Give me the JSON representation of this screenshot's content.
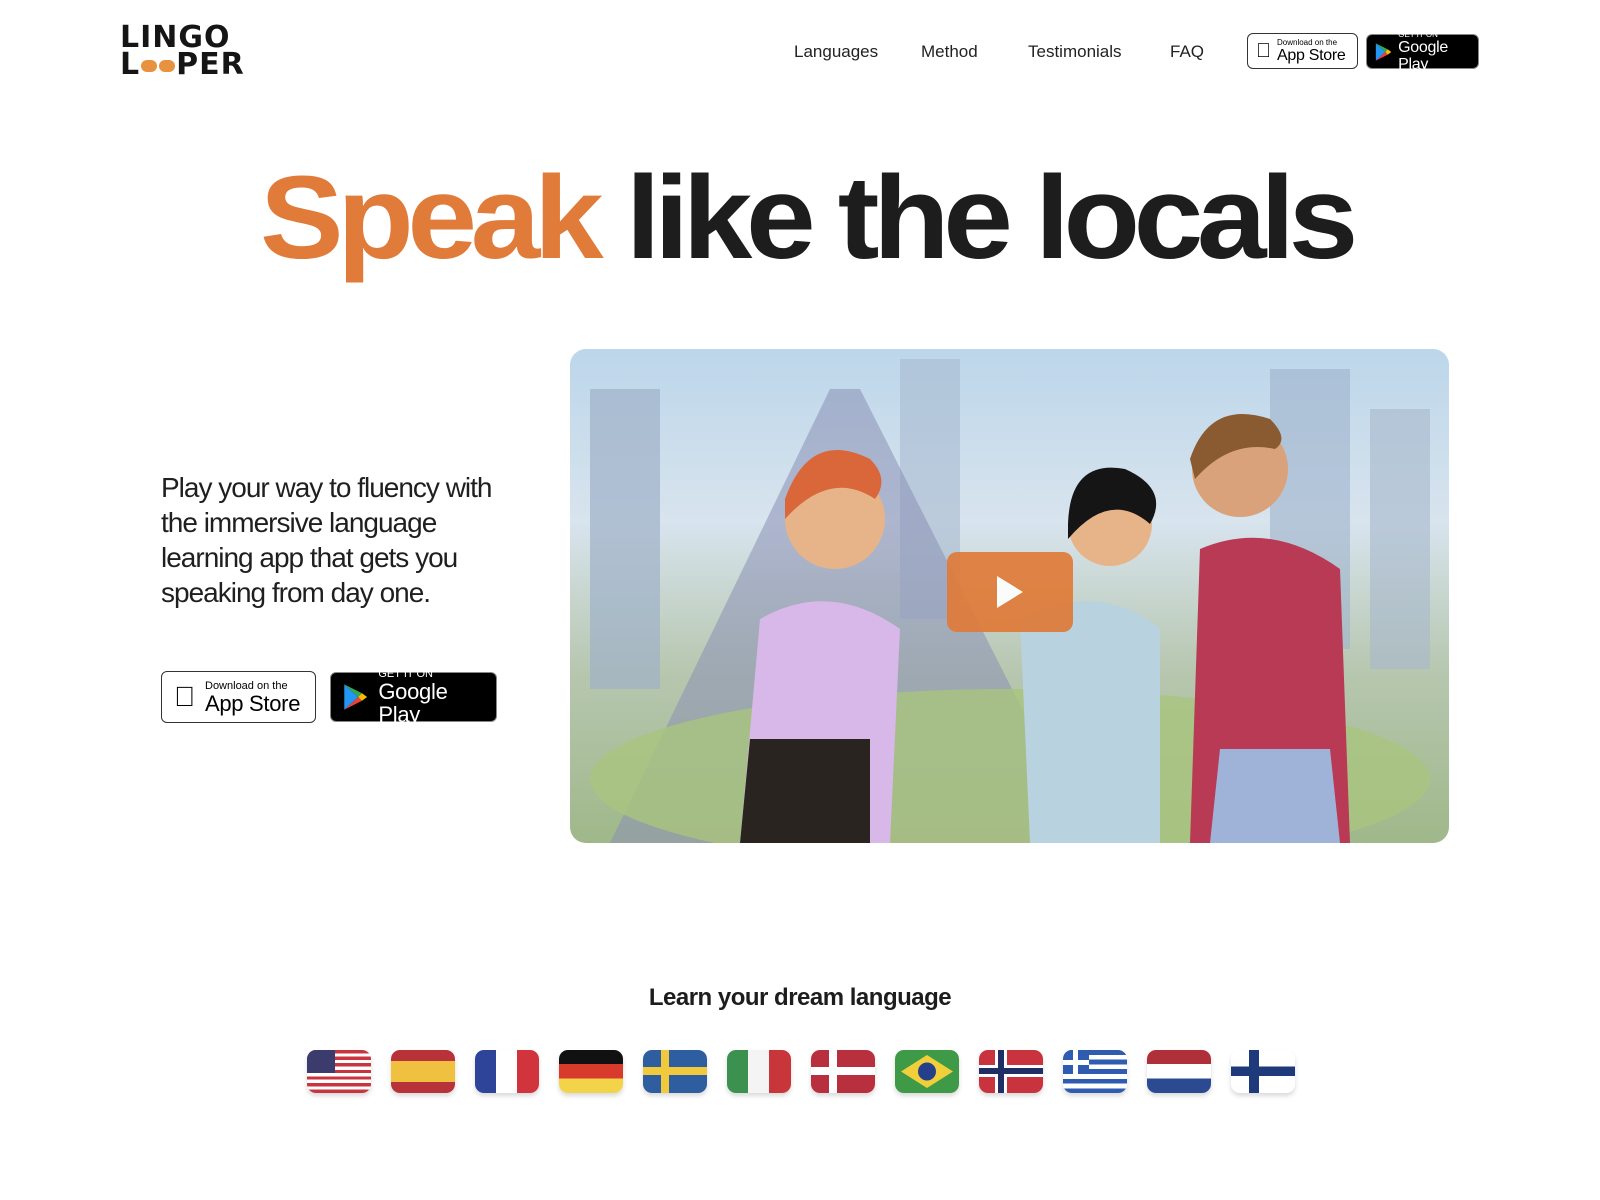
{
  "logo": {
    "line1": "LINGO",
    "line2_a": "L",
    "line2_b": "PER"
  },
  "nav": {
    "items": [
      "Languages",
      "Method",
      "Testimonials",
      "FAQ"
    ]
  },
  "badges": {
    "app_store": {
      "small": "Download on the",
      "big": "App Store"
    },
    "google_play": {
      "small": "GET IT ON",
      "big": "Google Play"
    }
  },
  "hero": {
    "headline_accent": "Speak",
    "headline_rest": "like the locals",
    "paragraph": "Play your way to fluency with the immersive language learning app that gets you speaking from day one.",
    "accent_color": "#e07b39"
  },
  "video": {
    "icon": "play-icon"
  },
  "languages": {
    "title": "Learn your dream language",
    "flags": [
      "us",
      "es",
      "fr",
      "de",
      "se",
      "it",
      "dk",
      "br",
      "no",
      "gr",
      "nl",
      "fi"
    ]
  }
}
